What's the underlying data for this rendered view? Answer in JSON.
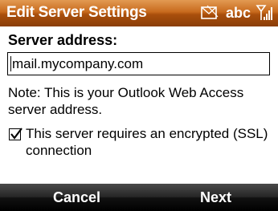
{
  "titlebar": {
    "title": "Edit Server Settings",
    "status": {
      "input_mode": "abc",
      "icons": [
        "message-icon",
        "signal-icon"
      ]
    }
  },
  "form": {
    "server_label": "Server address:",
    "server_value": "mail.mycompany.com",
    "note": "Note: This is your Outlook Web Access server address.",
    "ssl_checkbox": {
      "checked": true,
      "label": "This server requires an encrypted (SSL) connection"
    }
  },
  "softkeys": {
    "left": "Cancel",
    "right": "Next"
  },
  "colors": {
    "titlebar": "#c86a1d",
    "softbar": "#1a1a1a"
  }
}
